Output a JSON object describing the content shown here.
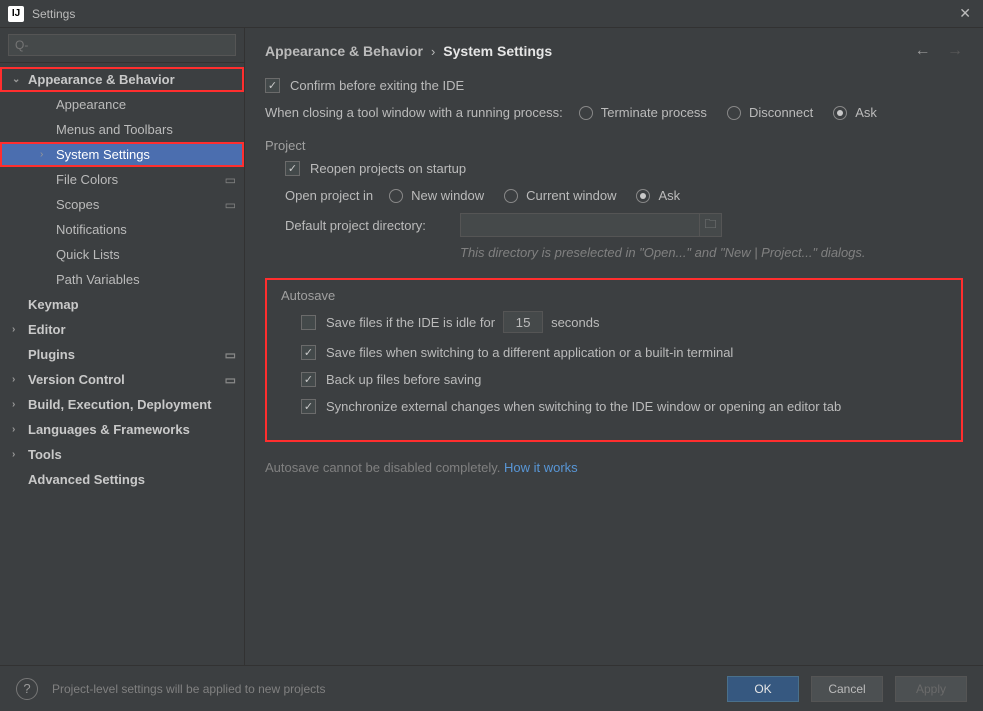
{
  "titlebar": {
    "title": "Settings"
  },
  "search": {
    "placeholder": "Q-"
  },
  "sidebar": {
    "items": [
      {
        "label": "Appearance & Behavior",
        "level": 0,
        "expandable": true,
        "expanded": true,
        "highlighted": true
      },
      {
        "label": "Appearance",
        "level": 1
      },
      {
        "label": "Menus and Toolbars",
        "level": 1
      },
      {
        "label": "System Settings",
        "level": 1,
        "expandable": true,
        "expanded": false,
        "selected": true,
        "highlighted": true
      },
      {
        "label": "File Colors",
        "level": 1,
        "projectIcon": true
      },
      {
        "label": "Scopes",
        "level": 1,
        "projectIcon": true
      },
      {
        "label": "Notifications",
        "level": 1
      },
      {
        "label": "Quick Lists",
        "level": 1
      },
      {
        "label": "Path Variables",
        "level": 1
      },
      {
        "label": "Keymap",
        "level": 0
      },
      {
        "label": "Editor",
        "level": 0,
        "expandable": true
      },
      {
        "label": "Plugins",
        "level": 0,
        "projectIcon": true
      },
      {
        "label": "Version Control",
        "level": 0,
        "expandable": true,
        "projectIcon": true
      },
      {
        "label": "Build, Execution, Deployment",
        "level": 0,
        "expandable": true
      },
      {
        "label": "Languages & Frameworks",
        "level": 0,
        "expandable": true
      },
      {
        "label": "Tools",
        "level": 0,
        "expandable": true
      },
      {
        "label": "Advanced Settings",
        "level": 0
      }
    ]
  },
  "breadcrumb": {
    "root": "Appearance & Behavior",
    "current": "System Settings"
  },
  "main": {
    "confirm_exit_label": "Confirm before exiting the IDE",
    "close_tool_label": "When closing a tool window with a running process:",
    "radio_terminate": "Terminate process",
    "radio_disconnect": "Disconnect",
    "radio_ask": "Ask",
    "project_title": "Project",
    "reopen_label": "Reopen projects on startup",
    "open_in_label": "Open project in",
    "radio_new_window": "New window",
    "radio_current_window": "Current window",
    "dir_label": "Default project directory:",
    "dir_hint": "This directory is preselected in \"Open...\" and \"New | Project...\" dialogs.",
    "autosave_title": "Autosave",
    "idle_prefix": "Save files if the IDE is idle for",
    "idle_value": "15",
    "idle_suffix": "seconds",
    "switch_app_label": "Save files when switching to a different application or a built-in terminal",
    "backup_label": "Back up files before saving",
    "sync_label": "Synchronize external changes when switching to the IDE window or opening an editor tab",
    "autosave_note_prefix": "Autosave cannot be disabled completely. ",
    "autosave_note_link": "How it works"
  },
  "footer": {
    "note": "Project-level settings will be applied to new projects",
    "ok": "OK",
    "cancel": "Cancel",
    "apply": "Apply"
  }
}
